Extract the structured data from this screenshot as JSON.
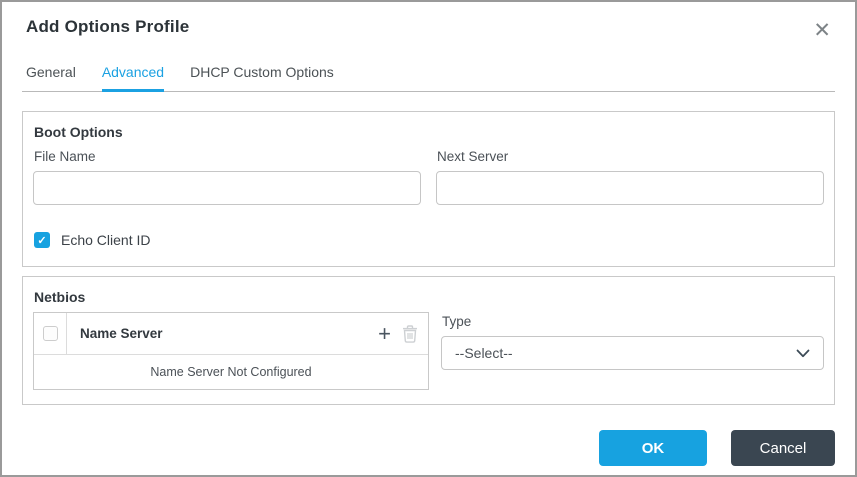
{
  "dialog": {
    "title": "Add Options Profile"
  },
  "icons": {
    "close": "✕",
    "plus": "+",
    "check": "✓"
  },
  "tabs": [
    {
      "label": "General",
      "active": false
    },
    {
      "label": "Advanced",
      "active": true
    },
    {
      "label": "DHCP Custom Options",
      "active": false
    }
  ],
  "boot_options": {
    "heading": "Boot Options",
    "file_name": {
      "label": "File Name",
      "value": ""
    },
    "next_server": {
      "label": "Next Server",
      "value": ""
    },
    "echo_client_id": {
      "label": "Echo Client ID",
      "checked": true
    }
  },
  "netbios": {
    "heading": "Netbios",
    "table": {
      "header": "Name Server",
      "header_checkbox_checked": false,
      "empty_message": "Name Server Not Configured"
    },
    "type": {
      "label": "Type",
      "selected": "--Select--"
    }
  },
  "footer": {
    "ok_label": "OK",
    "cancel_label": "Cancel"
  },
  "colors": {
    "accent_blue": "#17a2e0",
    "tab_active_blue": "#1ba1e2",
    "cancel_dark": "#3a4651",
    "border_gray": "#c9c9c9"
  }
}
